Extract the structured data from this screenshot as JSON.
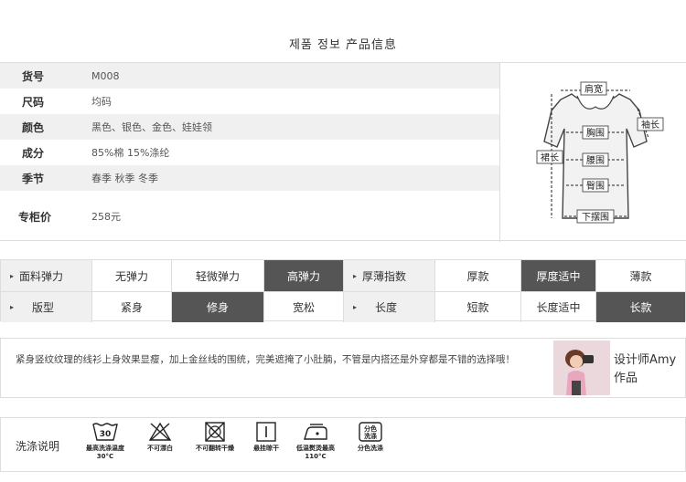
{
  "page_title": "제품 정보 产品信息",
  "info": [
    {
      "label": "货号",
      "value": "M008"
    },
    {
      "label": "尺码",
      "value": "均码"
    },
    {
      "label": "颜色",
      "value": "黑色、银色、金色、娃娃领"
    },
    {
      "label": "成分",
      "value": "85%棉   15%涤纶"
    },
    {
      "label": "季节",
      "value": "春季 秋季 冬季"
    },
    {
      "label": "专柜价",
      "value": "258元"
    }
  ],
  "diagram_labels": {
    "shoulder": "肩宽",
    "sleeve": "袖长",
    "chest": "胸围",
    "length": "裙长",
    "waist": "腰围",
    "hip": "臀围",
    "hem": "下摆围"
  },
  "attributes": [
    {
      "name": "面料弹力",
      "options": [
        "无弹力",
        "轻微弹力",
        "高弹力"
      ],
      "selected": 2
    },
    {
      "name": "厚薄指数",
      "options": [
        "厚款",
        "厚度适中",
        "薄款"
      ],
      "selected": 1
    },
    {
      "name": "版型",
      "options": [
        "紧身",
        "修身",
        "宽松"
      ],
      "selected": 1
    },
    {
      "name": "长度",
      "options": [
        "短款",
        "长度适中",
        "长款"
      ],
      "selected": 2
    }
  ],
  "description": "紧身竖纹纹理的线衫上身效果显瘦，加上金丝线的围统，完美遮掩了小肚腩，不管是内搭还是外穿都是不错的选择哦！",
  "designer": "设计师Amy作品",
  "care": {
    "title": "洗涤说明",
    "items": [
      {
        "icon": "wash-30-icon",
        "symbol": "30",
        "caption": "最高洗涤温度30°C"
      },
      {
        "icon": "no-bleach-icon",
        "caption": "不可漂白"
      },
      {
        "icon": "no-tumble-dry-icon",
        "caption": "不可翻转干燥"
      },
      {
        "icon": "hang-dry-icon",
        "caption": "悬挂晾干"
      },
      {
        "icon": "low-iron-icon",
        "caption": "低温熨烫最高110°C"
      },
      {
        "icon": "separate-wash-icon",
        "symbol": "分色洗涤",
        "caption": "分色洗涤"
      }
    ]
  }
}
